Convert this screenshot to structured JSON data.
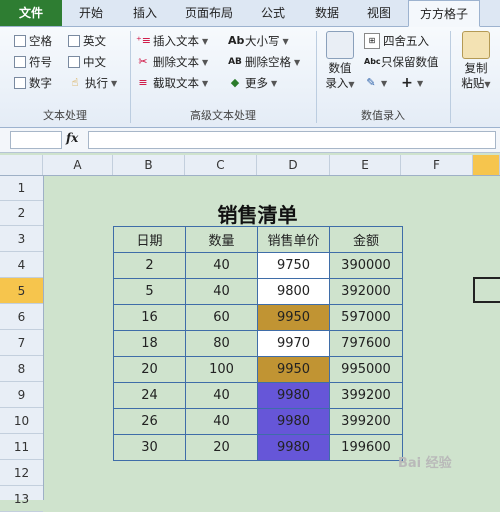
{
  "tabs": [
    "文件",
    "开始",
    "插入",
    "页面布局",
    "公式",
    "数据",
    "视图",
    "方方格子"
  ],
  "ribbon": {
    "text_group": {
      "items": [
        "空格",
        "英文",
        "符号",
        "中文",
        "数字",
        "执行"
      ],
      "label": "文本处理"
    },
    "advanced_group": {
      "items": [
        "插入文本",
        "删除文本",
        "截取文本",
        "大小写",
        "删除空格",
        "更多"
      ],
      "label": "高级文本处理"
    },
    "numeric_group": {
      "entry_label_1": "数值",
      "entry_label_2": "录入",
      "items": [
        "四舍五入",
        "只保留数值"
      ],
      "label": "数值录入"
    },
    "paste_group": {
      "label_1": "复制",
      "label_2": "粘贴"
    }
  },
  "formula_bar": {
    "fx": "fx"
  },
  "columns": [
    "A",
    "B",
    "C",
    "D",
    "E",
    "F"
  ],
  "rows": [
    "1",
    "2",
    "3",
    "4",
    "5",
    "6",
    "7",
    "8",
    "9",
    "10",
    "11",
    "12",
    "13"
  ],
  "sheet": {
    "title": "销售清单",
    "headers": [
      "日期",
      "数量",
      "销售单价",
      "金额"
    ],
    "rows": [
      [
        "2",
        "40",
        "9750",
        "390000"
      ],
      [
        "5",
        "40",
        "9800",
        "392000"
      ],
      [
        "16",
        "60",
        "9950",
        "597000"
      ],
      [
        "18",
        "80",
        "9970",
        "797600"
      ],
      [
        "20",
        "100",
        "9950",
        "995000"
      ],
      [
        "24",
        "40",
        "9980",
        "399200"
      ],
      [
        "26",
        "40",
        "9980",
        "399200"
      ],
      [
        "30",
        "20",
        "9980",
        "199600"
      ]
    ]
  },
  "watermark": "Bai 经验",
  "colors": {
    "file_tab": "#2e7d32",
    "gold": "#c19433",
    "purple": "#6656d8",
    "sheet_bg": "#cfe3cd",
    "selected_header": "#f6c54d"
  }
}
